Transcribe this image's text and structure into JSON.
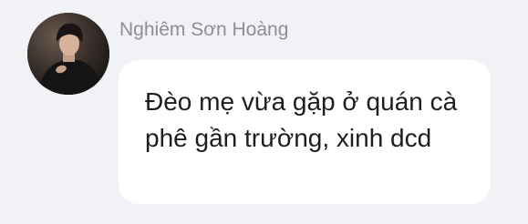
{
  "message": {
    "sender_name": "Nghiêm Sơn Hoàng",
    "text": "Đèo mẹ vừa gặp ở quán cà phê gần trường, xinh dcd",
    "avatar_icon": "profile-photo-person-in-dark-clothing"
  },
  "colors": {
    "background": "#f0f2f5",
    "bubble": "#ffffff",
    "sender_name": "#8d8f93",
    "text": "#1c1e21"
  }
}
